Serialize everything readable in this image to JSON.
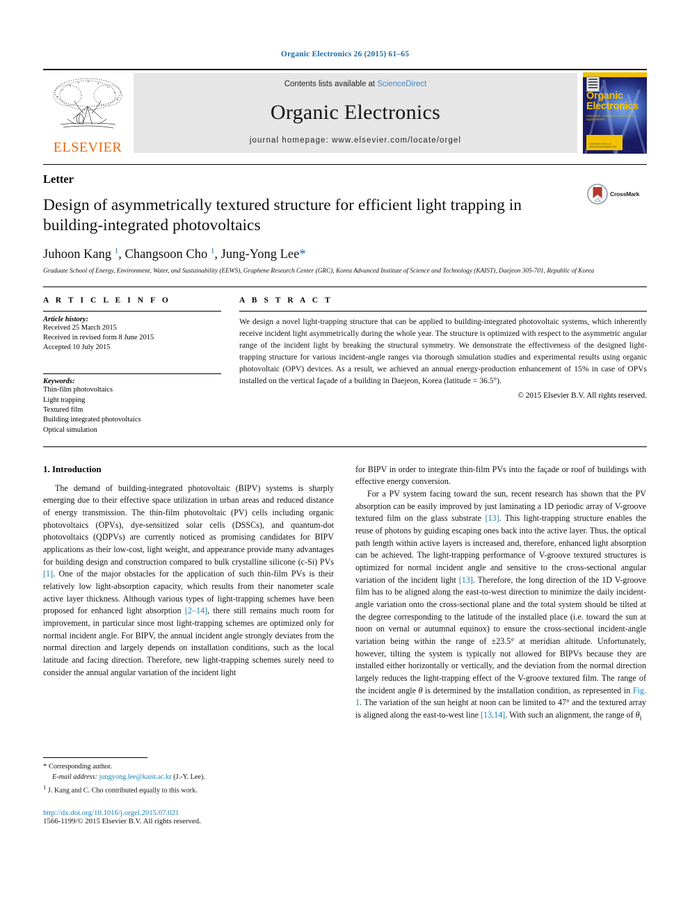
{
  "running_head": "Organic Electronics 26 (2015) 61–65",
  "masthead": {
    "publisher": "ELSEVIER",
    "contents_prefix": "Contents lists available at ",
    "contents_link": "ScienceDirect",
    "journal_title": "Organic Electronics",
    "homepage": "journal homepage: www.elsevier.com/locate/orgel",
    "cover": {
      "title_line1": "Organic",
      "title_line2": "Electronics",
      "subtitle": "materials • physics • chemistry • applications",
      "footer_text": "available online at www.sciencedirect.com"
    }
  },
  "article": {
    "type": "Letter",
    "title": "Design of asymmetrically textured structure for efficient light trapping in building-integrated photovoltaics",
    "crossmark_label": "CrossMark",
    "authors_html": "Juhoon Kang <sup>1</sup>, Changsoon Cho <sup>1</sup>, Jung-Yong Lee<span class=\"star\">*</span>",
    "affiliation": "Graduate School of Energy, Environment, Water, and Sustainability (EEWS), Graphene Research Center (GRC), Korea Advanced Institute of Science and Technology (KAIST), Daejeon 305-701, Republic of Korea"
  },
  "info": {
    "heading": "A R T I C L E   I N F O",
    "history_label": "Article history:",
    "history": [
      "Received 25 March 2015",
      "Received in revised form 8 June 2015",
      "Accepted 10 July 2015"
    ],
    "keywords_label": "Keywords:",
    "keywords": [
      "Thin-film photovoltaics",
      "Light trapping",
      "Textured film",
      "Building integrated photovoltaics",
      "Optical simulation"
    ]
  },
  "abstract": {
    "heading": "A B S T R A C T",
    "text": "We design a novel light-trapping structure that can be applied to building-integrated photovoltaic systems, which inherently receive incident light asymmetrically during the whole year. The structure is optimized with respect to the asymmetric angular range of the incident light by breaking the structural symmetry. We demonstrate the effectiveness of the designed light-trapping structure for various incident-angle ranges via thorough simulation studies and experimental results using organic photovoltaic (OPV) devices. As a result, we achieved an annual energy-production enhancement of 15% in case of OPVs installed on the vertical façade of a building in Daejeon, Korea (latitude = 36.5°).",
    "copyright": "© 2015 Elsevier B.V. All rights reserved."
  },
  "body": {
    "section_title": "1. Introduction",
    "left_para1_html": "The demand of building-integrated photovoltaic (BIPV) systems is sharply emerging due to their effective space utilization in urban areas and reduced distance of energy transmission. The thin-film photovoltaic (PV) cells including organic photovoltaics (OPVs), dye-sensitized solar cells (DSSCs), and quantum-dot photovoltaics (QDPVs) are currently noticed as promising candidates for BIPV applications as their low-cost, light weight, and appearance provide many advantages for building design and construction compared to bulk crystalline silicone (c-Si) PVs <span class=\"ref\">[1]</span>. One of the major obstacles for the application of such thin-film PVs is their relatively low light-absorption capacity, which results from their nanometer scale active layer thickness. Although various types of light-trapping schemes have been proposed for enhanced light absorption <span class=\"ref\">[2–14]</span>, there still remains much room for improvement, in particular since most light-trapping schemes are optimized only for normal incident angle. For BIPV, the annual incident angle strongly deviates from the normal direction and largely depends on installation conditions, such as the local latitude and facing direction. Therefore, new light-trapping schemes surely need to consider the annual angular variation of the incident light",
    "right_para1_html": "for BIPV in order to integrate thin-film PVs into the façade or roof of buildings with effective energy conversion.",
    "right_para2_html": "For a PV system facing toward the sun, recent research has shown that the PV absorption can be easily improved by just laminating a 1D periodic array of V-groove textured film on the glass substrate <span class=\"ref\">[13]</span>. This light-trapping structure enables the reuse of photons by guiding escaping ones back into the active layer. Thus, the optical path length within active layers is increased and, therefore, enhanced light absorption can be achieved. The light-trapping performance of V-groove textured structures is optimized for normal incident angle and sensitive to the cross-sectional angular variation of the incident light <span class=\"ref\">[13]</span>. Therefore, the long direction of the 1D V-groove film has to be aligned along the east-to-west direction to minimize the daily incident-angle variation onto the cross-sectional plane and the total system should be tilted at the degree corresponding to the latitude of the installed place (i.e. toward the sun at noon on vernal or autumnal equinox) to ensure the cross-sectional incident-angle variation being within the range of ±23.5° at meridian altitude. Unfortunately, however, tilting the system is typically not allowed for BIPVs because they are installed either horizontally or vertically, and the deviation from the normal direction largely reduces the light-trapping effect of the V-groove textured film. The range of the incident angle <i>θ</i> is determined by the installation condition, as represented in <span class=\"ref\">Fig. 1</span>. The variation of the sun height at noon can be limited to 47° and the textured array is aligned along the east-to-west line <span class=\"ref\">[13,14]</span>. With such an alignment, the range of <i>θ</i><sub>i</sub>"
  },
  "footnotes": {
    "corresponding_html": "<span style=\"font-size:11px\">*</span> Corresponding author.",
    "email_html": "<i>E-mail address:</i> <span class=\"fn-mail\">jungyong.lee@kaist.ac.kr</span> (J.-Y. Lee).",
    "equal_html": "<sup>1</sup> J. Kang and C. Cho contributed equally to this work.",
    "doi": "http://dx.doi.org/10.1016/j.orgel.2015.07.021",
    "issn": "1566-1199/© 2015 Elsevier B.V. All rights reserved."
  },
  "colors": {
    "link": "#1b7fb5",
    "running_head": "#1b6ba6",
    "elsevier_orange": "#ec6608",
    "cover_yellow": "#f2c200"
  }
}
